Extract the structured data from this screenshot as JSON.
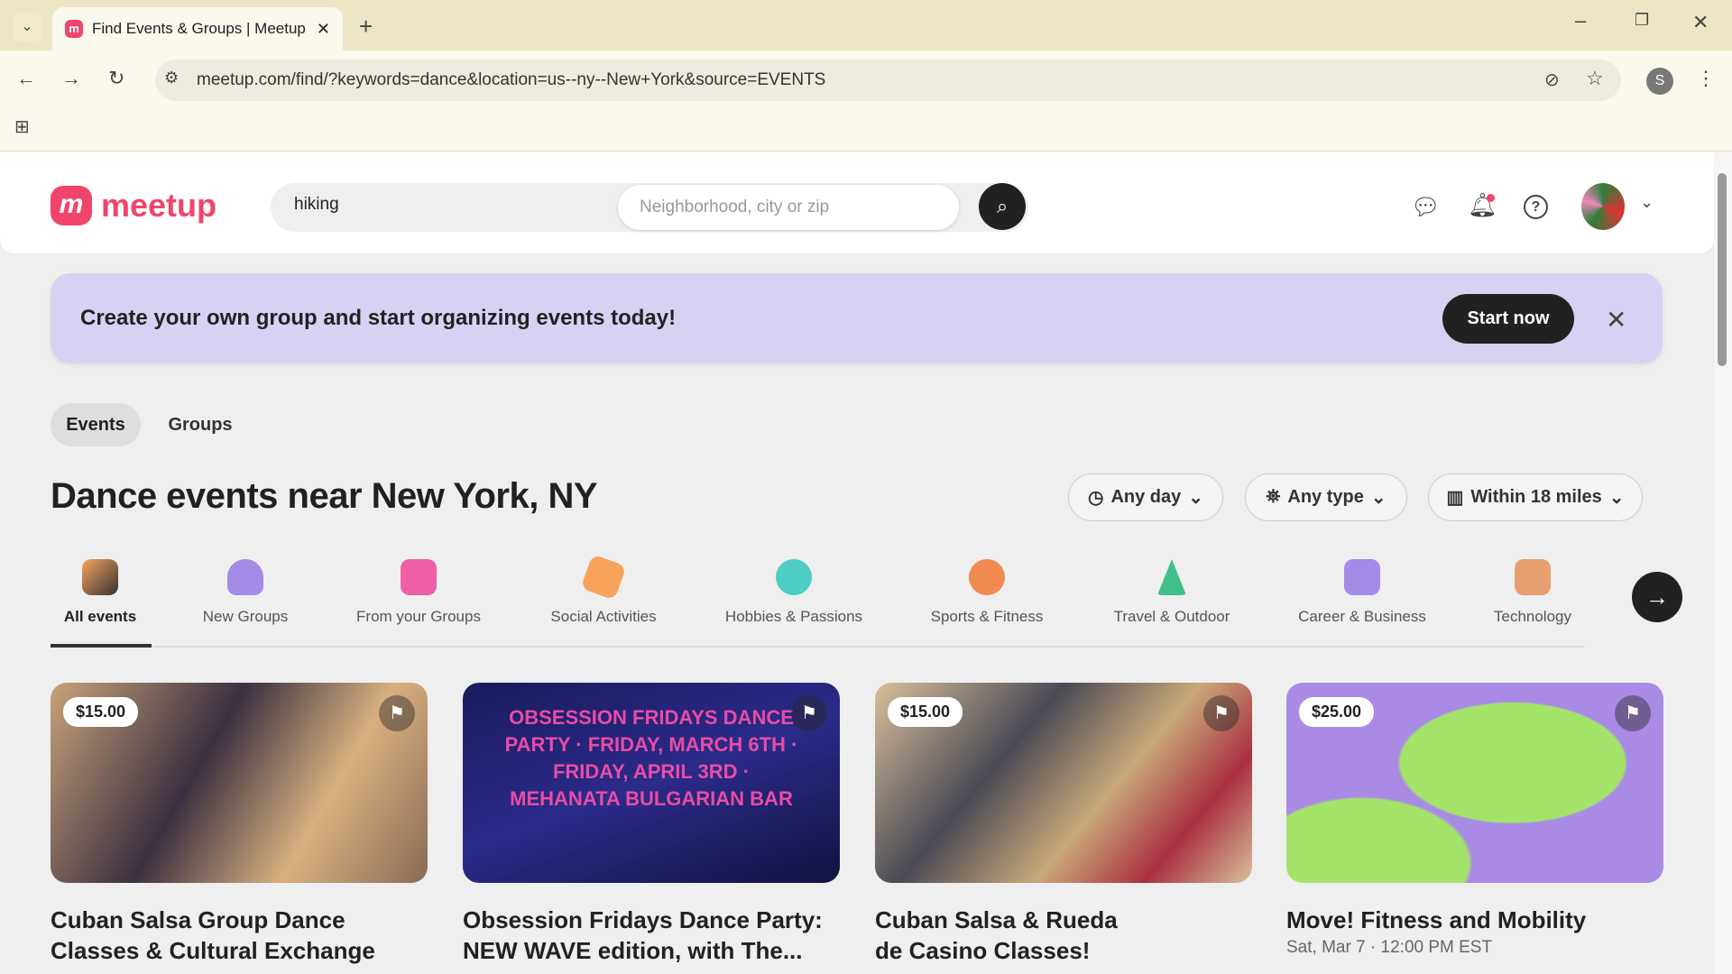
{
  "browser": {
    "tab_title": "Find Events & Groups | Meetup",
    "url": "meetup.com/find/?keywords=dance&location=us--ny--New+York&source=EVENTS",
    "profile_initial": "S"
  },
  "header": {
    "logo": "meetup",
    "keyword": "hiking",
    "location_placeholder": "Neighborhood, city or zip"
  },
  "banner": {
    "text": "Create your own group and start organizing events today!",
    "button": "Start now"
  },
  "tabs": [
    "Events",
    "Groups"
  ],
  "heading": "Dance events near New York, NY",
  "filters": [
    "Any day",
    "Any type",
    "Within 18 miles"
  ],
  "categories": [
    "All events",
    "New Groups",
    "From your Groups",
    "Social Activities",
    "Hobbies & Passions",
    "Sports & Fitness",
    "Travel & Outdoor",
    "Career & Business",
    "Technology"
  ],
  "cards": [
    {
      "price": "$15.00",
      "title": "Cuban Salsa Group Dance Classes & Cultural Exchange"
    },
    {
      "price": "",
      "title": "Obsession Fridays Dance Party: NEW WAVE edition, with The...",
      "poster": "OBSESSION FRIDAYS DANCE PARTY · FRIDAY, MARCH 6TH · FRIDAY, APRIL 3RD · MEHANATA BULGARIAN BAR"
    },
    {
      "price": "$15.00",
      "title": "Cuban Salsa & Rueda de Casino Classes!"
    },
    {
      "price": "$25.00",
      "title": "Move! Fitness and Mobility",
      "date": "Sat, Mar 7 · 12:00 PM EST"
    }
  ]
}
